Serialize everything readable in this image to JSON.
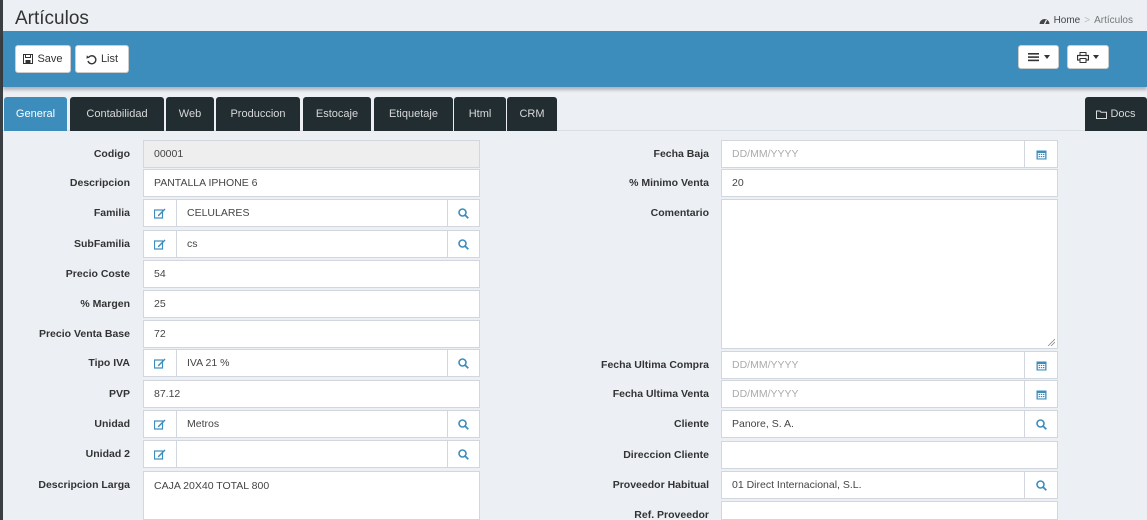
{
  "header": {
    "title": "Artículos",
    "breadcrumb_home": "Home",
    "breadcrumb_sep": ">",
    "breadcrumb_current": "Artículos"
  },
  "toolbar": {
    "save_label": "Save",
    "list_label": "List"
  },
  "tabs": [
    "General",
    "Contabilidad",
    "Web",
    "Produccion",
    "Estocaje",
    "Etiquetaje",
    "Html",
    "CRM"
  ],
  "docs_label": "Docs",
  "active_tab": "General",
  "colors": {
    "accent": "#3c8dbc",
    "tab_dark": "#222d32",
    "page_bg": "#ecf0f5"
  },
  "left": {
    "codigo": {
      "label": "Codigo",
      "value": "00001"
    },
    "descripcion": {
      "label": "Descripcion",
      "value": "PANTALLA IPHONE 6"
    },
    "familia": {
      "label": "Familia",
      "value": "CELULARES"
    },
    "subfamilia": {
      "label": "SubFamilia",
      "value": "cs"
    },
    "precio_coste": {
      "label": "Precio Coste",
      "value": "54"
    },
    "margen": {
      "label": "% Margen",
      "value": "25"
    },
    "precio_venta_base": {
      "label": "Precio Venta Base",
      "value": "72"
    },
    "tipo_iva": {
      "label": "Tipo IVA",
      "value": "IVA 21 %"
    },
    "pvp": {
      "label": "PVP",
      "value": "87.12"
    },
    "unidad": {
      "label": "Unidad",
      "value": "Metros"
    },
    "unidad2": {
      "label": "Unidad 2",
      "value": ""
    },
    "descripcion_larga": {
      "label": "Descripcion Larga",
      "value": "CAJA 20X40 TOTAL 800"
    }
  },
  "right": {
    "fecha_baja": {
      "label": "Fecha Baja",
      "placeholder": "DD/MM/YYYY"
    },
    "minimo_venta": {
      "label": "% Minimo Venta",
      "value": "20"
    },
    "comentario": {
      "label": "Comentario",
      "value": ""
    },
    "fecha_ultima_compra": {
      "label": "Fecha Ultima Compra",
      "placeholder": "DD/MM/YYYY"
    },
    "fecha_ultima_venta": {
      "label": "Fecha Ultima Venta",
      "placeholder": "DD/MM/YYYY"
    },
    "cliente": {
      "label": "Cliente",
      "value": "Panore, S. A."
    },
    "direccion_cliente": {
      "label": "Direccion Cliente",
      "value": ""
    },
    "proveedor_habitual": {
      "label": "Proveedor Habitual",
      "value": "01 Direct Internacional, S.L."
    },
    "ref_proveedor": {
      "label": "Ref. Proveedor",
      "value": ""
    }
  }
}
